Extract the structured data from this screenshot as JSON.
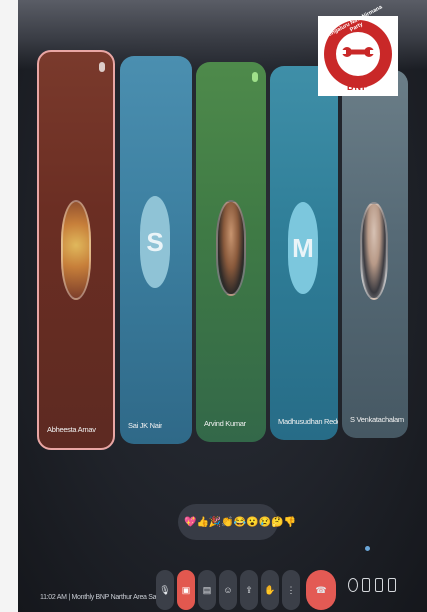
{
  "participants": [
    {
      "name": "Abheesta Arnav",
      "avatar_type": "photo",
      "initial": ""
    },
    {
      "name": "Sai JK Nair",
      "avatar_type": "initial",
      "initial": "S"
    },
    {
      "name": "Arvind Kumar",
      "avatar_type": "photo",
      "initial": ""
    },
    {
      "name": "Madhusudhan Reddy (Mad...",
      "avatar_type": "initial",
      "initial": "M"
    },
    {
      "name": "S Venkatachalam",
      "avatar_type": "photo",
      "initial": ""
    }
  ],
  "logo": {
    "ring_text": "Bengaluru NavaNirmana Party",
    "abbr": "BNP",
    "color": "#c92828"
  },
  "reactions": [
    "💖",
    "👍",
    "🎉",
    "👏",
    "😂",
    "😮",
    "😢",
    "🤔",
    "👎"
  ],
  "meeting": {
    "time": "11:02 AM",
    "separator": "|",
    "title": "Monthly BNP Narthur Area Sabha ..."
  },
  "controls": [
    {
      "name": "mic-button",
      "icon": "mic-icon"
    },
    {
      "name": "camera-off-button",
      "icon": "camera-off-icon"
    },
    {
      "name": "captions-button",
      "icon": "captions-icon"
    },
    {
      "name": "emoji-button",
      "icon": "emoji-icon"
    },
    {
      "name": "present-button",
      "icon": "present-icon"
    },
    {
      "name": "raise-hand-button",
      "icon": "hand-icon"
    },
    {
      "name": "more-options-button",
      "icon": "more-icon"
    },
    {
      "name": "end-call-button",
      "icon": "phone-hangup-icon"
    }
  ],
  "side_controls": [
    "info-icon",
    "people-icon",
    "chat-icon",
    "activities-icon"
  ]
}
